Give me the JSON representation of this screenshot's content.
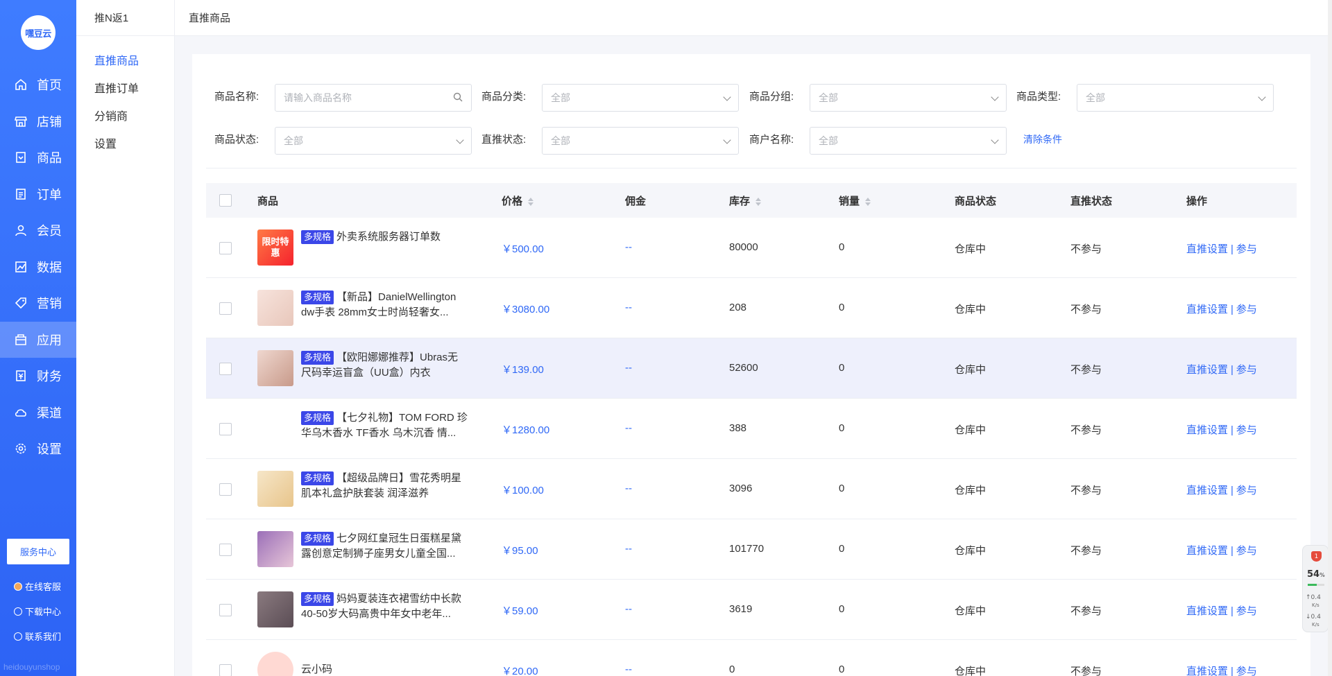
{
  "logo": {
    "text": "嘿豆云"
  },
  "nav": {
    "items": [
      {
        "label": "首页",
        "icon": "home-icon"
      },
      {
        "label": "店铺",
        "icon": "store-icon"
      },
      {
        "label": "商品",
        "icon": "goods-icon"
      },
      {
        "label": "订单",
        "icon": "order-icon"
      },
      {
        "label": "会员",
        "icon": "member-icon"
      },
      {
        "label": "数据",
        "icon": "data-icon"
      },
      {
        "label": "营销",
        "icon": "tag-icon"
      },
      {
        "label": "应用",
        "icon": "app-icon",
        "active": true
      },
      {
        "label": "财务",
        "icon": "finance-icon"
      },
      {
        "label": "渠道",
        "icon": "channel-icon"
      },
      {
        "label": "设置",
        "icon": "gear-icon"
      }
    ]
  },
  "sidebar_bottom": {
    "service": "服务中心",
    "online": "在线客服",
    "download": "下载中心",
    "contact": "联系我们",
    "watermark": "heidouyunshop"
  },
  "subside": {
    "title": "推N返1",
    "items": [
      "直推商品",
      "直推订单",
      "分销商",
      "设置"
    ]
  },
  "breadcrumb": "直推商品",
  "filters": {
    "name_label": "商品名称:",
    "name_placeholder": "请输入商品名称",
    "category_label": "商品分类:",
    "category_value": "全部",
    "group_label": "商品分组:",
    "group_value": "全部",
    "type_label": "商品类型:",
    "type_value": "全部",
    "status_label": "商品状态:",
    "status_value": "全部",
    "push_label": "直推状态:",
    "push_value": "全部",
    "merchant_label": "商户名称:",
    "merchant_value": "全部",
    "clear": "清除条件"
  },
  "table": {
    "headers": {
      "goods": "商品",
      "price": "价格",
      "commission": "佣金",
      "stock": "库存",
      "sales": "销量",
      "status": "商品状态",
      "push": "直推状态",
      "ops": "操作"
    },
    "tag": "多规格",
    "op_setting": "直推设置",
    "op_sep": "|",
    "op_join": "参与",
    "rows": [
      {
        "tag": true,
        "name": "外卖系统服务器订单数",
        "price": "￥500.00",
        "commission": "--",
        "stock": "80000",
        "sales": "0",
        "status": "仓库中",
        "push": "不参与",
        "thumb_text": "限时特惠"
      },
      {
        "tag": true,
        "name": "【新品】DanielWellington dw手表 28mm女士时尚轻奢女...",
        "price": "￥3080.00",
        "commission": "--",
        "stock": "208",
        "sales": "0",
        "status": "仓库中",
        "push": "不参与"
      },
      {
        "tag": true,
        "name": "【欧阳娜娜推荐】Ubras无尺码幸运盲盒（UU盒）内衣",
        "price": "￥139.00",
        "commission": "--",
        "stock": "52600",
        "sales": "0",
        "status": "仓库中",
        "push": "不参与"
      },
      {
        "tag": true,
        "name": "【七夕礼物】TOM FORD 珍华乌木香水 TF香水 乌木沉香 情...",
        "price": "￥1280.00",
        "commission": "--",
        "stock": "388",
        "sales": "0",
        "status": "仓库中",
        "push": "不参与"
      },
      {
        "tag": true,
        "name": "【超级品牌日】雪花秀明星肌本礼盒护肤套装 润泽滋养",
        "price": "￥100.00",
        "commission": "--",
        "stock": "3096",
        "sales": "0",
        "status": "仓库中",
        "push": "不参与"
      },
      {
        "tag": true,
        "name": "七夕网红皇冠生日蛋糕星黛露创意定制狮子座男女儿童全国...",
        "price": "￥95.00",
        "commission": "--",
        "stock": "101770",
        "sales": "0",
        "status": "仓库中",
        "push": "不参与"
      },
      {
        "tag": true,
        "name": "妈妈夏装连衣裙雪纺中长款40-50岁大码高贵中年女中老年...",
        "price": "￥59.00",
        "commission": "--",
        "stock": "3619",
        "sales": "0",
        "status": "仓库中",
        "push": "不参与"
      },
      {
        "tag": false,
        "name": "云小码",
        "price": "￥20.00",
        "commission": "--",
        "stock": "0",
        "sales": "0",
        "status": "仓库中",
        "push": "不参与"
      }
    ]
  },
  "widget": {
    "percent": "54",
    "percent_unit": "%",
    "up": "0.4",
    "down": "0.4",
    "unit": "K/s",
    "badge": "1",
    "fill": 0.54
  },
  "colors": {
    "primary": "#2f68f6",
    "tag": "#3b47e8",
    "highlight_row": "#eef0fc"
  }
}
